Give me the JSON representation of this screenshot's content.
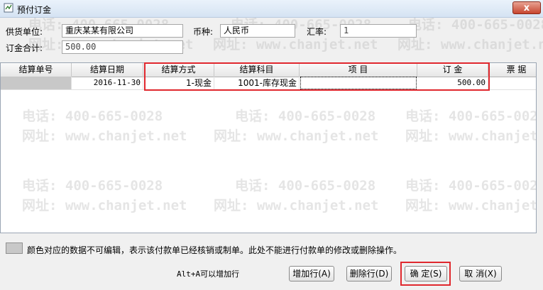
{
  "window": {
    "title": "预付订金",
    "close_label": "x"
  },
  "form": {
    "supplier_label": "供货单位:",
    "supplier_value": "重庆某某有限公司",
    "currency_label": "币种:",
    "currency_value": "人民币",
    "rate_label": "汇率:",
    "rate_value": "1",
    "total_label": "订金合计:",
    "total_value": "500.00"
  },
  "table": {
    "columns": [
      "结算单号",
      "结算日期",
      "结算方式",
      "结算科目",
      "项  目",
      "订  金",
      "票 据"
    ],
    "rows": [
      {
        "settle_no": "",
        "settle_date": "2016-11-30",
        "settle_method": "1-现金",
        "settle_account": "1001-库存现金",
        "project": "",
        "deposit": "500.00",
        "bill": ""
      }
    ]
  },
  "watermark": {
    "phone": "电话: 400-665-0028",
    "site": "网址: www.chanjet.net"
  },
  "legend_text": "颜色对应的数据不可编辑，表示该付款单已经核销或制单。此处不能进行付款单的修改或删除操作。",
  "footer": {
    "hint": "Alt+A可以增加行",
    "add_row": "增加行(A)",
    "delete_row": "删除行(D)",
    "confirm": "确  定(S)",
    "cancel": "取 消(X)"
  },
  "colors": {
    "highlight": "#e0282e",
    "readonly_cell": "#c8c8c8"
  }
}
